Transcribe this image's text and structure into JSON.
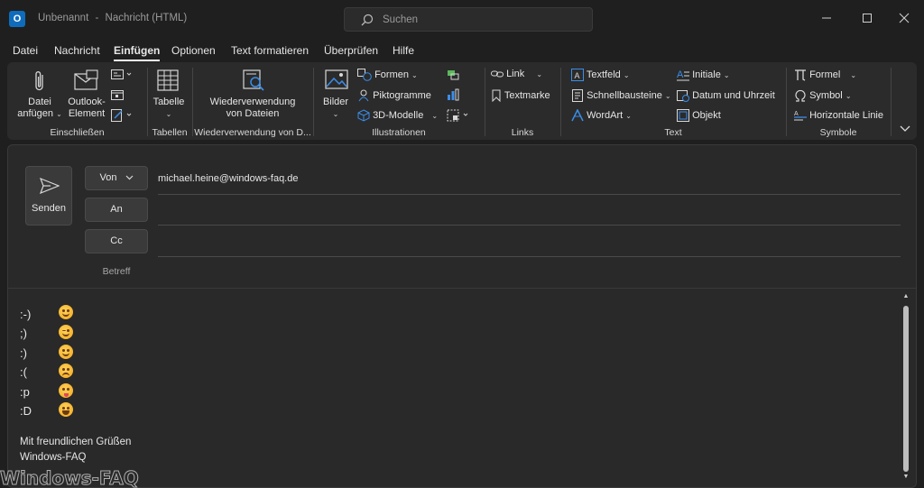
{
  "window": {
    "title_doc": "Unbenannt",
    "title_sep": "-",
    "title_type": "Nachricht (HTML)",
    "logo_letter": "O",
    "search_placeholder": "Suchen"
  },
  "menu": {
    "tabs": [
      "Datei",
      "Nachricht",
      "Einfügen",
      "Optionen",
      "Text formatieren",
      "Überprüfen",
      "Hilfe"
    ],
    "active": "Einfügen"
  },
  "ribbon": {
    "einschliessen": {
      "label": "Einschließen",
      "datei_line1": "Datei",
      "datei_line2": "anfügen",
      "outlook_line1": "Outlook-",
      "outlook_line2": "Element"
    },
    "tabellen": {
      "label": "Tabellen",
      "tabelle": "Tabelle"
    },
    "wiederverwendung": {
      "label": "Wiederverwendung von D...",
      "btn_line1": "Wiederverwendung",
      "btn_line2": "von Dateien"
    },
    "illustrationen": {
      "label": "Illustrationen",
      "bilder": "Bilder",
      "formen": "Formen",
      "piktogramme": "Piktogramme",
      "modelle": "3D-Modelle"
    },
    "links": {
      "label": "Links",
      "link": "Link",
      "textmarke": "Textmarke"
    },
    "text": {
      "label": "Text",
      "textfeld": "Textfeld",
      "schnellbausteine": "Schnellbausteine",
      "wordart": "WordArt",
      "initiale": "Initiale",
      "datum": "Datum und Uhrzeit",
      "objekt": "Objekt"
    },
    "symbole": {
      "label": "Symbole",
      "formel": "Formel",
      "symbol": "Symbol",
      "linie": "Horizontale Linie"
    }
  },
  "compose": {
    "send_label": "Senden",
    "von_label": "Von",
    "von_value": "michael.heine@windows-faq.de",
    "an_label": "An",
    "cc_label": "Cc",
    "betreff_label": "Betreff"
  },
  "body": {
    "emoticons": [
      {
        "code": ":-)",
        "emoji": "smile"
      },
      {
        "code": ";)",
        "emoji": "wink"
      },
      {
        "code": ":)",
        "emoji": "smile"
      },
      {
        "code": ":(",
        "emoji": "sad"
      },
      {
        "code": ":p",
        "emoji": "tongue"
      },
      {
        "code": ":D",
        "emoji": "grin"
      }
    ],
    "signature_line1": "Mit freundlichen Grüßen",
    "signature_line2": "Windows-FAQ"
  },
  "watermark": "Windows-FAQ",
  "colors": {
    "accent": "#0f6cbd",
    "background": "#1f1f1f",
    "ribbon": "#2b2b2b"
  }
}
